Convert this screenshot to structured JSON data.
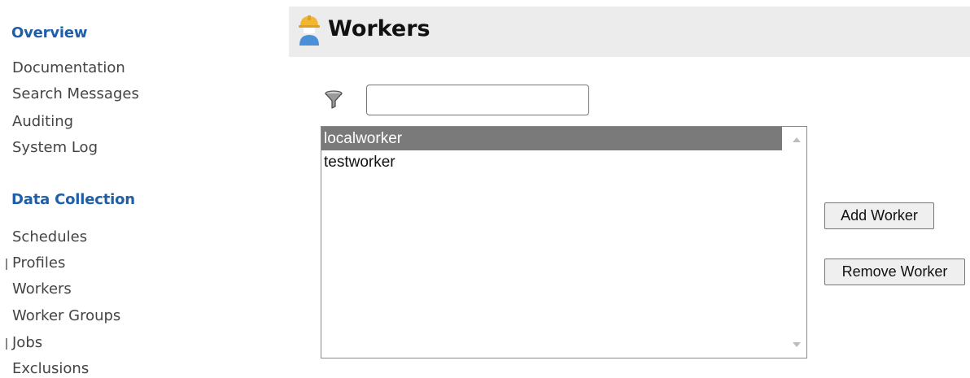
{
  "sidebar": {
    "sections": [
      {
        "title": "Overview",
        "items": [
          "Documentation",
          "Search Messages",
          "Auditing",
          "System Log"
        ]
      },
      {
        "title": "Data Collection",
        "items": [
          "Schedules",
          "Profiles",
          "Workers",
          "Worker Groups",
          "Jobs",
          "Exclusions"
        ]
      }
    ]
  },
  "header": {
    "title": "Workers",
    "icon": "worker-hardhat-icon"
  },
  "filter": {
    "icon": "filter-funnel-icon",
    "value": "",
    "placeholder": ""
  },
  "workers_list": {
    "options": [
      "localworker",
      "testworker"
    ],
    "selected": "localworker"
  },
  "buttons": {
    "add_label": "Add Worker",
    "remove_label": "Remove Worker"
  },
  "colors": {
    "section_title": "#1f5fa8",
    "header_bg": "#ececec",
    "selected_row": "#7a7a7a",
    "hardhat": "#f2b632",
    "person": "#4a90d9"
  }
}
